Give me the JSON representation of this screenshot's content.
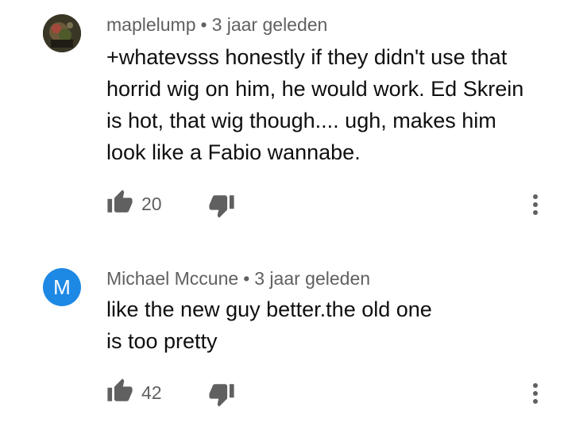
{
  "comments": [
    {
      "author": "maplelump",
      "separator": "•",
      "time": "3 jaar geleden",
      "text_lines": [
        "+whatevsss honestly if they didn't use that",
        "horrid wig on him, he would work. Ed Skrein",
        "is hot, that wig though.... ugh, makes him",
        "look like a Fabio wannabe."
      ],
      "likes": "20",
      "avatar": {
        "type": "image"
      }
    },
    {
      "author": "Michael Mccune",
      "separator": "•",
      "time": "3 jaar geleden",
      "text_lines": [
        "like the new guy better.the old one",
        "is too pretty"
      ],
      "likes": "42",
      "avatar": {
        "type": "letter",
        "letter": "M",
        "color": "#1e88e5"
      }
    }
  ],
  "icons": {
    "like": "thumbs-up-icon",
    "dislike": "thumbs-down-icon",
    "more": "more-vert-icon"
  },
  "colors": {
    "meta_text": "#606060",
    "body_text": "#0f0f0f",
    "icon": "#606060"
  }
}
